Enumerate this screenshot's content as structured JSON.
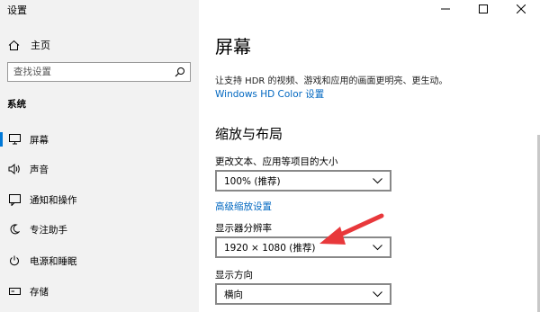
{
  "window": {
    "title": "设置"
  },
  "sidebar": {
    "home_label": "主页",
    "search_placeholder": "查找设置",
    "section_label": "系统",
    "items": [
      {
        "label": "屏幕",
        "icon": "monitor-icon",
        "active": true
      },
      {
        "label": "声音",
        "icon": "speaker-icon"
      },
      {
        "label": "通知和操作",
        "icon": "notification-icon"
      },
      {
        "label": "专注助手",
        "icon": "moon-icon"
      },
      {
        "label": "电源和睡眠",
        "icon": "power-icon"
      },
      {
        "label": "存储",
        "icon": "storage-icon"
      }
    ]
  },
  "main": {
    "title": "屏幕",
    "hdr_description": "让支持 HDR 的视频、游戏和应用的画面更明亮、更生动。",
    "hdr_link": "Windows HD Color 设置",
    "scale_section_title": "缩放与布局",
    "scale_label": "更改文本、应用等项目的大小",
    "scale_value": "100% (推荐)",
    "advanced_scaling_link": "高级缩放设置",
    "resolution_label": "显示器分辨率",
    "resolution_value": "1920 × 1080 (推荐)",
    "orientation_label": "显示方向",
    "orientation_value": "横向"
  },
  "colors": {
    "accent": "#0078d7",
    "link": "#0067c0",
    "annotation_arrow": "#e8383b"
  }
}
